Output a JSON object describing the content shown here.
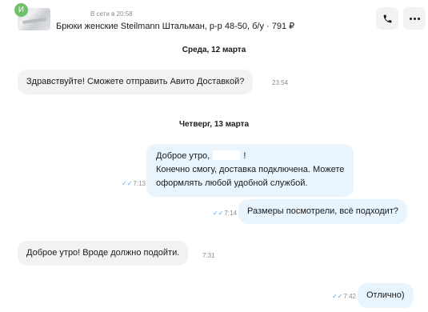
{
  "header": {
    "avatar_letter": "И",
    "status": "В сети в 20:58",
    "listing_title": "Брюки женские Steilmann Штальман, р-р 48-50, б/у · 791 ₽",
    "call_icon": "phone-icon",
    "more_icon": "more-dots-icon"
  },
  "dates": {
    "first": "Среда, 12 марта",
    "second": "Четверг, 13 марта"
  },
  "messages": [
    {
      "direction": "incoming",
      "text": "Здравствуйте! Сможете отправить Авито Доставкой?",
      "time": "23:54"
    },
    {
      "direction": "outgoing",
      "line1_prefix": "Доброе утро,",
      "line1_suffix": "!",
      "line2": "Конечно смогу, доставка подключена. Можете",
      "line3": "оформлять любой удобной службой.",
      "time": "7:13",
      "read": "✓✓"
    },
    {
      "direction": "outgoing",
      "text": "Размеры посмотрели, всё подходит?",
      "time": "7:14",
      "read": "✓✓"
    },
    {
      "direction": "incoming",
      "text": "Доброе утро! Вроде должно подойти.",
      "time": "7:31"
    },
    {
      "direction": "outgoing",
      "text": "Отлично)",
      "time": "7:42",
      "read": "✓✓"
    }
  ],
  "colors": {
    "incoming_bubble": "#f2f2f3",
    "outgoing_bubble": "#e8f4fe",
    "read_ticks": "#5ba4e8",
    "avatar": "#6ec06a"
  }
}
